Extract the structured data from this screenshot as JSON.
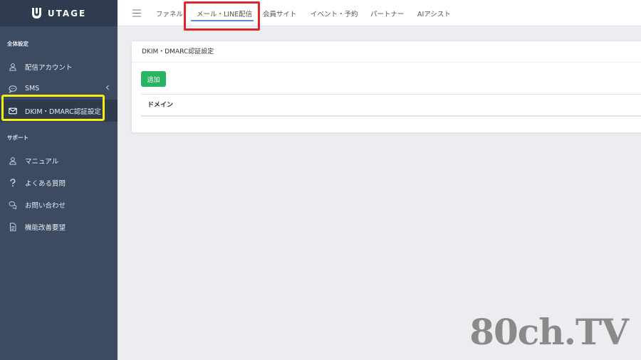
{
  "app": {
    "logo_text": "UTAGE"
  },
  "sidebar": {
    "section_general": "全体設定",
    "section_support": "サポート",
    "general_items": [
      {
        "label": "配信アカウント",
        "icon": "user-icon"
      },
      {
        "label": "SMS",
        "icon": "chat-bubble-icon"
      },
      {
        "label": "DKIM・DMARC認証設定",
        "icon": "envelope-icon",
        "active": true
      }
    ],
    "support_items": [
      {
        "label": "マニュアル",
        "icon": "user-icon"
      },
      {
        "label": "よくある質問",
        "icon": "question-icon"
      },
      {
        "label": "お問い合わせ",
        "icon": "chat-bubbles-icon"
      },
      {
        "label": "機能改善要望",
        "icon": "document-icon"
      }
    ]
  },
  "topnav": {
    "tabs": [
      {
        "label": "ファネル"
      },
      {
        "label": "メール・LINE配信",
        "active": true
      },
      {
        "label": "会員サイト"
      },
      {
        "label": "イベント・予約"
      },
      {
        "label": "パートナー"
      },
      {
        "label": "AIアシスト"
      }
    ]
  },
  "main": {
    "card_title": "DKIM・DMARC認証設定",
    "add_button": "追加",
    "table_headers": [
      "ドメイン"
    ]
  },
  "watermark": "80ch.TV",
  "colors": {
    "sidebar_bg": "#3d4b62",
    "accent_green": "#28b463",
    "tab_underline": "#4a8fd0",
    "annotation_red": "#e3262b",
    "annotation_yellow": "#f4ef1a"
  }
}
